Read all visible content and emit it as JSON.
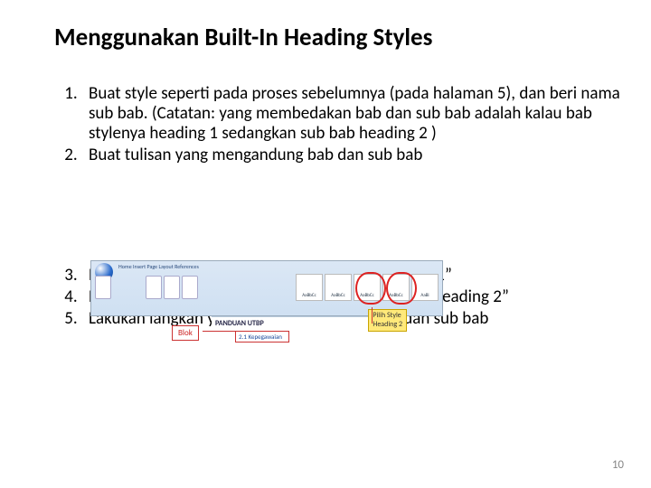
{
  "title": "Menggunakan Built-In Heading Styles",
  "steps": {
    "s1": "Buat style seperti pada proses sebelumnya (pada halaman 5), dan beri nama sub bab. (Catatan: yang membedakan bab dan sub bab adalah kalau bab stylenya heading 1 sedangkan sub bab heading 2 )",
    "s2": "Buat tulisan yang mengandung bab dan sub bab",
    "s3": "Blok judul bab dan beri style “bab” atau “heading 1”",
    "s4": "Blok judul sub bab dan beri style “sub bab” atau “heading 2”",
    "s5": "Lakukan langkah yang sama pada semua bab dan sub bab"
  },
  "figure": {
    "tabs": "Home   Insert   Page Layout   References",
    "doc_title": "PANDUAN UTBP",
    "highlight_text": "2.1 Kepegawaian",
    "callout_blok": "Blok",
    "callout_pilih_line1": "Pilih Style",
    "callout_pilih_line2": "Heading 2",
    "style_labels": [
      "AaBbCc",
      "AaBbCc",
      "AaBbCc",
      "AaBbCc",
      "AaBi"
    ]
  },
  "page_number": "10"
}
